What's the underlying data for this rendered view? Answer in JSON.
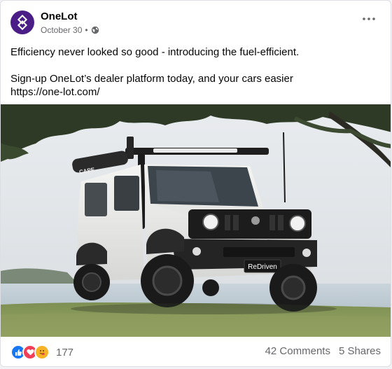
{
  "post": {
    "author": "OneLot",
    "date": "October 30",
    "separator": "•",
    "audience_icon": "globe-icon",
    "text_line1": "Efficiency never looked so good - introducing the fuel-efficient.",
    "text_line2": "Sign-up OneLot’s dealer platform today, and your cars easier",
    "link": "https://one-lot.com/",
    "photo_badge": "ReDriven",
    "photo_logo": "CAPE"
  },
  "reactions": {
    "icons": [
      "like-icon",
      "love-icon",
      "care-icon"
    ],
    "count": "177"
  },
  "stats": {
    "comments": "42 Comments",
    "shares": "5 Shares"
  },
  "colors": {
    "brand": "#4a1e86",
    "like": "#1877f2",
    "love": "#f33e58",
    "care": "#f7b125",
    "secondary_text": "#65676b"
  }
}
